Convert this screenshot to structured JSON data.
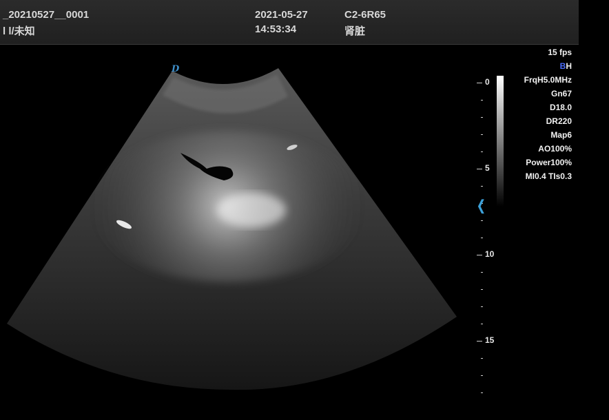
{
  "header": {
    "exam_id": "_20210527__0001",
    "patient": "l l/未知",
    "date": "2021-05-27",
    "time": "14:53:34",
    "probe": "C2-6R65",
    "organ": "肾脏"
  },
  "fps": "15 fps",
  "mode": {
    "b": "B",
    "h": "H"
  },
  "params": [
    "FrqH5.0MHz",
    "Gn67",
    "D18.0",
    "DR220",
    "Map6",
    "AO100%",
    "Power100%",
    "MI0.4 TIs0.3"
  ],
  "orientation_marker": "D",
  "depth_scale": {
    "labels": [
      "0",
      "5",
      "10",
      "15"
    ]
  },
  "colors": {
    "orientation": "#3e8ec8",
    "focus": "#3ca0d8",
    "mode_b": "#4a6cff"
  },
  "icons": {
    "focus": "focus-chevron-icon"
  }
}
